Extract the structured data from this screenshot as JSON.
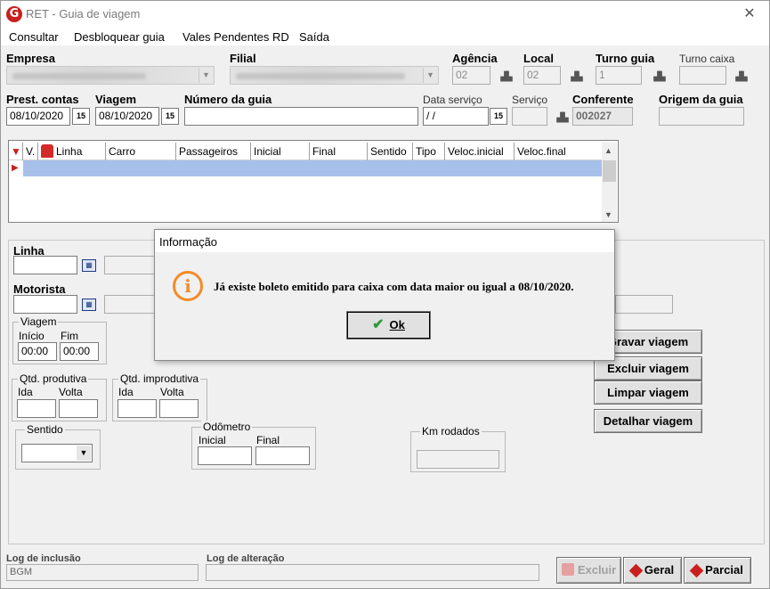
{
  "window": {
    "title": "RET - Guia de viagem",
    "close_glyph": "✕",
    "app_icon_letter": "G"
  },
  "menu": {
    "items": [
      "Consultar",
      "Desbloquear guia",
      "Vales Pendentes RD",
      "Saída"
    ]
  },
  "form": {
    "empresa_label": "Empresa",
    "filial_label": "Filial",
    "agencia_label": "Agência",
    "agencia_value": "02",
    "local_label": "Local",
    "local_value": "02",
    "turno_guia_label": "Turno guia",
    "turno_guia_value": "1",
    "turno_caixa_label": "Turno caixa",
    "prest_contas_label": "Prest. contas",
    "prest_contas_value": "08/10/2020",
    "viagem_label": "Viagem",
    "viagem_value": "08/10/2020",
    "numero_guia_label": "Número da guia",
    "data_servico_label": "Data serviço",
    "data_servico_value": " / /",
    "servico_label": "Serviço",
    "conferente_label": "Conferente",
    "conferente_value": "002027",
    "origem_guia_label": "Origem da guia",
    "cal_glyph": "15"
  },
  "grid": {
    "columns": [
      "V.",
      "Linha",
      "Carro",
      "Passageiros",
      "Inicial",
      "Final",
      "Sentido",
      "Tipo",
      "Veloc.inicial",
      "Veloc.final"
    ]
  },
  "detail": {
    "linha_label": "Linha",
    "motorista_label": "Motorista",
    "viagem_group": "Viagem",
    "inicio_label": "Início",
    "fim_label": "Fim",
    "inicio_value": "00:00",
    "fim_value": "00:00",
    "qtd_produtiva": "Qtd. produtiva",
    "qtd_improdutiva": "Qtd. improdutiva",
    "ida_label": "Ida",
    "volta_label": "Volta",
    "sentido_group": "Sentido",
    "odometro_group": "Odômetro",
    "odo_inicial": "Inicial",
    "odo_final": "Final",
    "km_rodados": "Km rodados"
  },
  "actions": {
    "gravar": "Gravar viagem",
    "excluir": "Excluir viagem",
    "limpar": "Limpar viagem",
    "detalhar": "Detalhar viagem"
  },
  "footer": {
    "log_inclusao_label": "Log de inclusão",
    "log_inclusao_value": "BGM",
    "log_alteracao_label": "Log de alteração",
    "excluir_btn": "Excluir",
    "geral_btn": "Geral",
    "parcial_btn": "Parcial"
  },
  "dialog": {
    "title": "Informação",
    "icon_glyph": "i",
    "message": "Já existe boleto emitido para caixa com data maior ou igual a 08/10/2020.",
    "ok": "Ok"
  },
  "colors": {
    "selection_row": "#a7c0ea",
    "info_icon": "#f28c28",
    "brand_red": "#c8201e"
  }
}
